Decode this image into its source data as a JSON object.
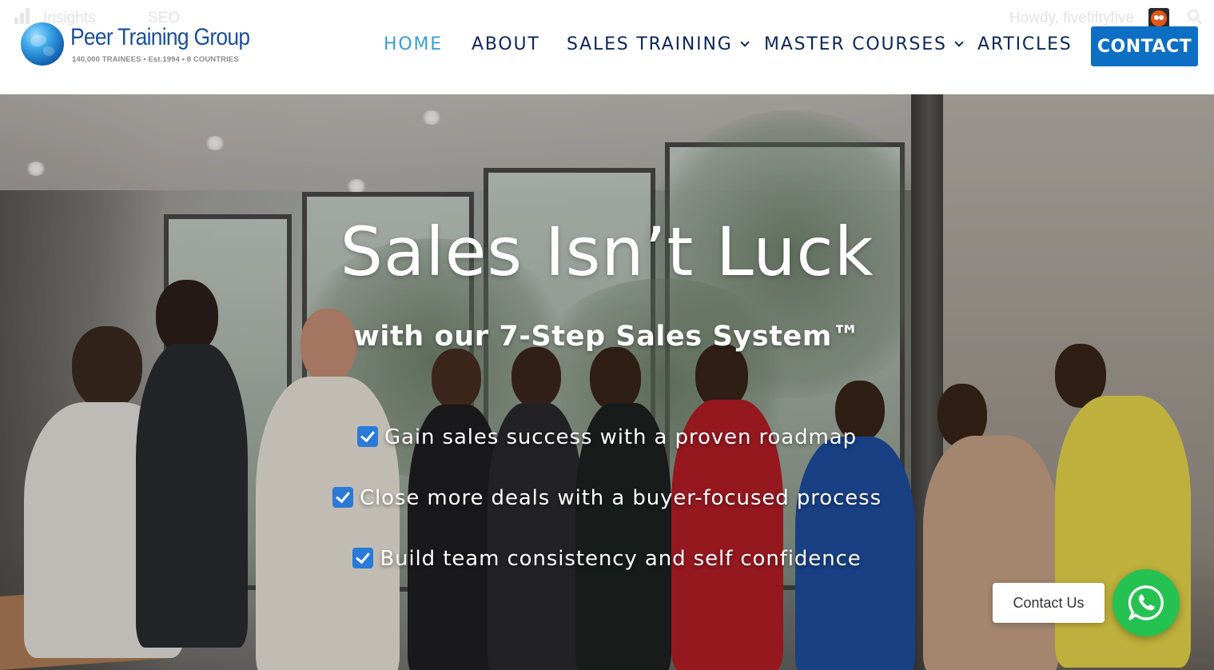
{
  "adminbar": {
    "insights_label": "Insights",
    "seo_label": "SEO",
    "howdy_label": "Howdy, fivefiftyfive"
  },
  "logo": {
    "name": "Peer Training Group",
    "tagline": "140,000 TRAINEES • Est.1994 • 8 COUNTRIES"
  },
  "nav": {
    "home": "HOME",
    "about": "ABOUT",
    "sales_training": "SALES TRAINING",
    "master_courses": "MASTER COURSES",
    "articles": "ARTICLES",
    "contact": "CONTACT",
    "active": "HOME"
  },
  "hero": {
    "title": "Sales Isn’t Luck",
    "subtitle": "with our 7-Step Sales System™",
    "bullets": [
      "Gain sales success with a proven roadmap",
      "Close more deals with a buyer-focused process",
      "Build team consistency and self confidence"
    ]
  },
  "widgets": {
    "contact_us": "Contact Us"
  },
  "colors": {
    "navy": "#0c2657",
    "active_link": "#3c9fd0",
    "contact_button": "#0c6fc4",
    "check_blue": "#2a7ad8",
    "whatsapp_green": "#25c251"
  }
}
